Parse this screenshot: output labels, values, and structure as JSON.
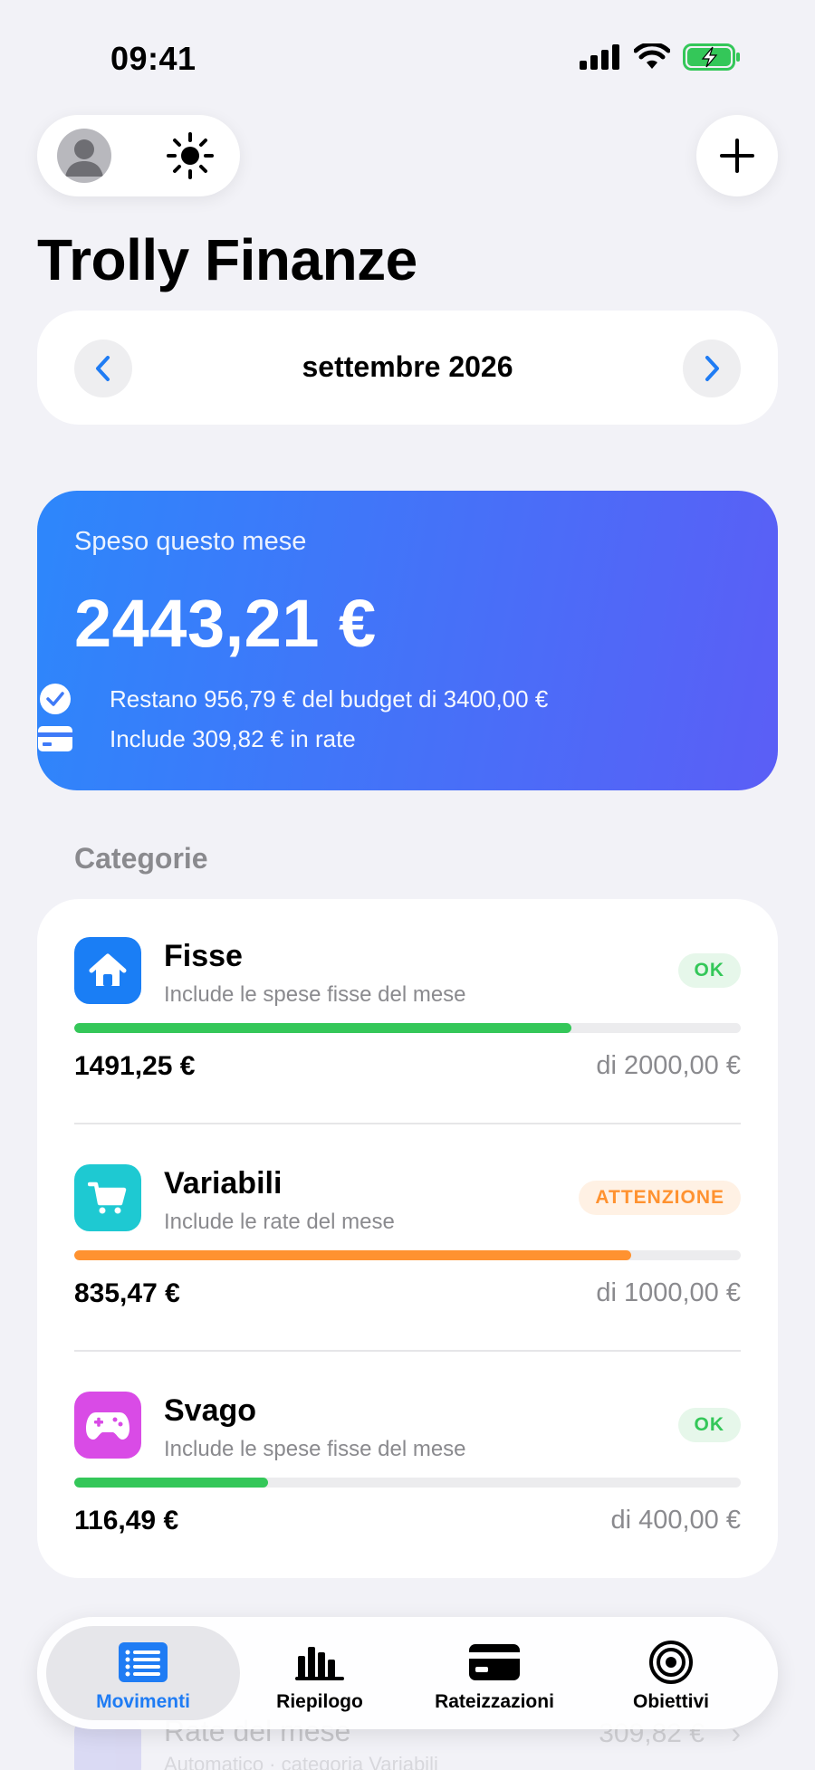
{
  "status": {
    "time": "09:41"
  },
  "header": {
    "title": "Trolly Finanze"
  },
  "month_nav": {
    "label": "settembre 2026"
  },
  "summary": {
    "label": "Speso questo mese",
    "amount": "2443,21 €",
    "remaining_text": "Restano 956,79 € del budget di 3400,00 €",
    "installments_text": "Include 309,82 € in rate"
  },
  "categories": {
    "title": "Categorie",
    "items": [
      {
        "name": "Fisse",
        "subtitle": "Include le spese fisse del mese",
        "status": "OK",
        "spent": "1491,25 €",
        "limit": "di 2000,00 €",
        "progress": 0.746,
        "color": "#34c759",
        "icon_color": "#1a7ef5"
      },
      {
        "name": "Variabili",
        "subtitle": "Include le rate del mese",
        "status": "ATTENZIONE",
        "spent": "835,47 €",
        "limit": "di 1000,00 €",
        "progress": 0.835,
        "color": "#ff9230",
        "icon_color": "#1ec9d2"
      },
      {
        "name": "Svago",
        "subtitle": "Include le spese fisse del mese",
        "status": "OK",
        "spent": "116,49 €",
        "limit": "di 400,00 €",
        "progress": 0.291,
        "color": "#34c759",
        "icon_color": "#d94be6"
      }
    ]
  },
  "behind": {
    "title": "Rate del mese",
    "subtitle": "Automatico · categoria Variabili",
    "amount": "309,82 €"
  },
  "tabbar": {
    "tabs": [
      {
        "label": "Movimenti",
        "icon": "list-icon",
        "active": true
      },
      {
        "label": "Riepilogo",
        "icon": "bar-chart-icon",
        "active": false
      },
      {
        "label": "Rateizzazioni",
        "icon": "credit-card-icon",
        "active": false
      },
      {
        "label": "Obiettivi",
        "icon": "target-icon",
        "active": false
      }
    ]
  },
  "colors": {
    "accent": "#1f7cf4",
    "ok": "#34c759",
    "warn": "#ff9230"
  }
}
